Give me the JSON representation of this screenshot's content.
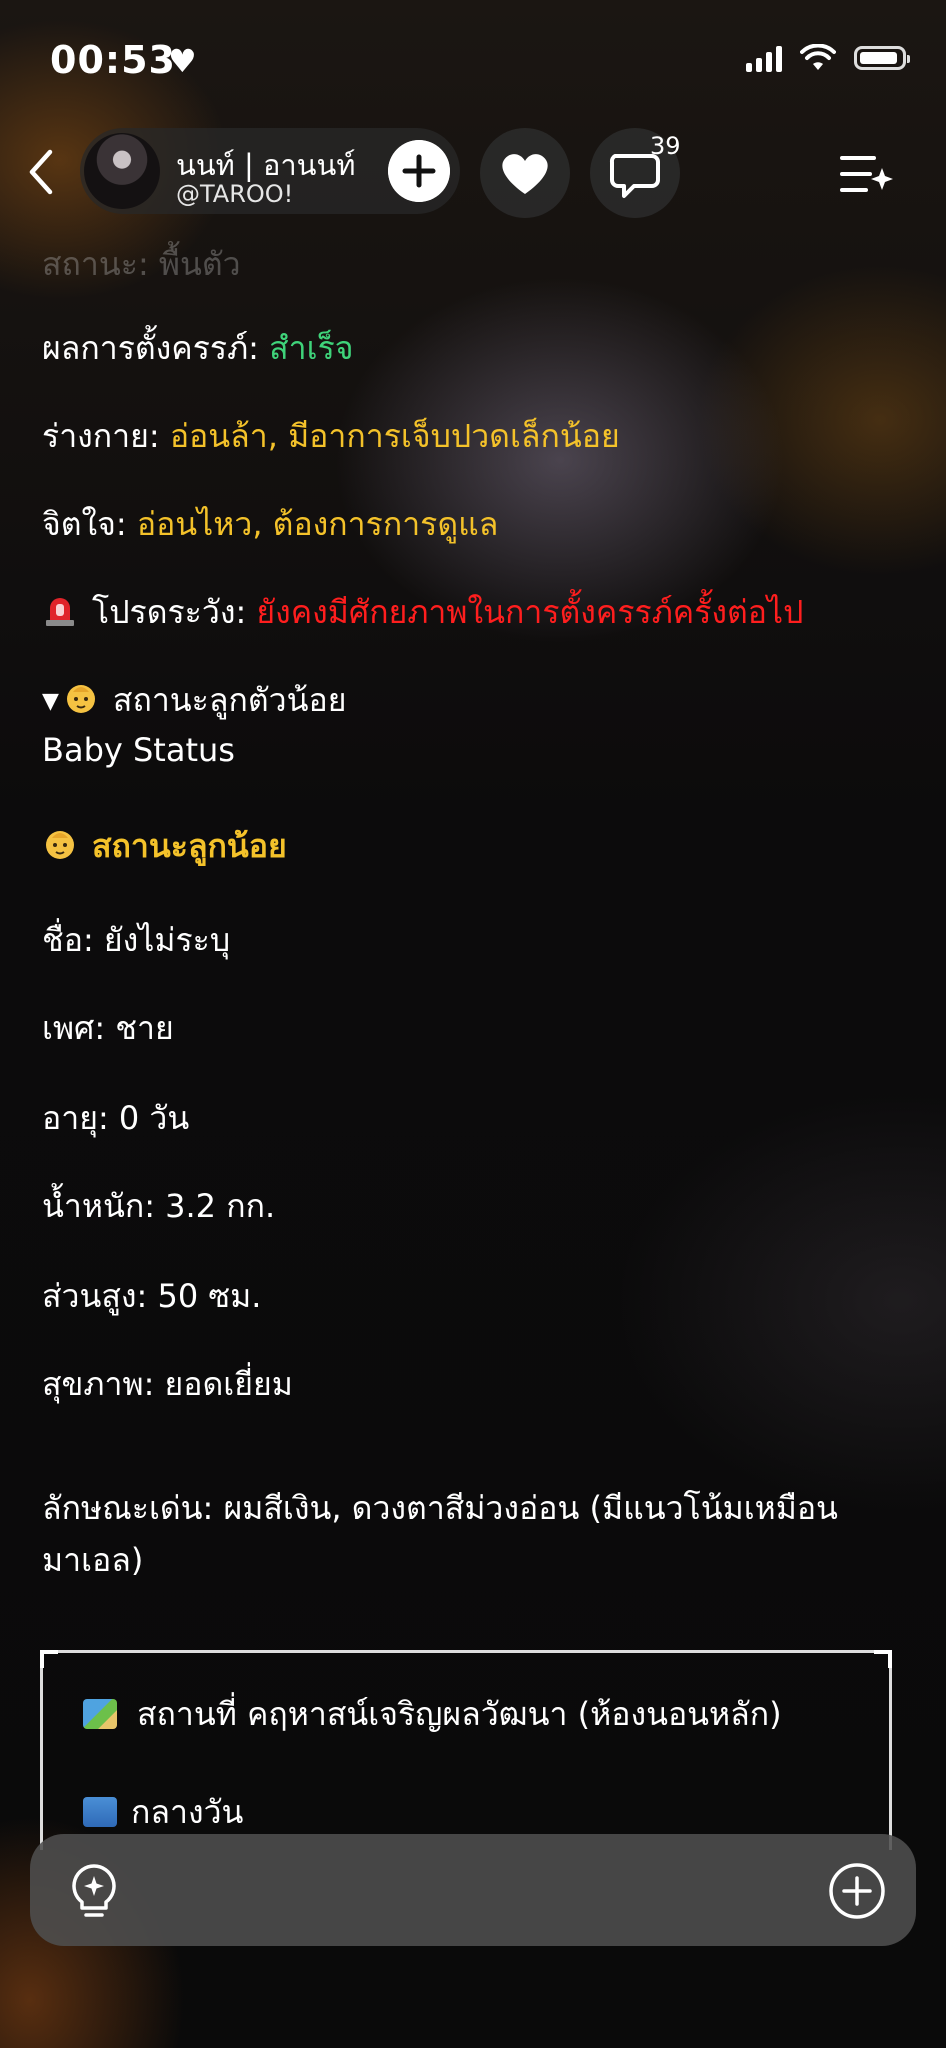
{
  "status_bar": {
    "time": "00:53",
    "time_suffix": "♥"
  },
  "header": {
    "name": "นนท์ | อานนท์",
    "handle": "@TAROO!",
    "comment_count": "39"
  },
  "status_lines": {
    "cut_off_line": "สถานะ: พื้นตัว",
    "pregnancy_label": "ผลการตั้งครรภ์: ",
    "pregnancy_value": "สำเร็จ",
    "body_label": "ร่างกาย: ",
    "body_value": "อ่อนล้า, มีอาการเจ็บปวดเล็กน้อย",
    "mind_label": "จิตใจ: ",
    "mind_value": "อ่อนไหว, ต้องการการดูแล",
    "warning_label": "โปรดระวัง: ",
    "warning_value": "ยังคงมีศักยภาพในการตั้งครรภ์ครั้งต่อไป"
  },
  "baby_toggle": {
    "arrow": "▼",
    "title": "สถานะลูกตัวน้อย",
    "subtitle": "Baby Status"
  },
  "baby_section": {
    "heading": "สถานะลูกน้อย",
    "name": "ชื่อ: ยังไม่ระบุ",
    "gender": "เพศ: ชาย",
    "age": "อายุ: 0 วัน",
    "weight": "น้ำหนัก: 3.2 กก.",
    "height": "ส่วนสูง: 50 ซม.",
    "health": "สุขภาพ: ยอดเยี่ยม",
    "features_line1": "ลักษณะเด่น: ผมสีเงิน, ดวงตาสีม่วงอ่อน (มีแนวโน้มเหมือน",
    "features_line2": "มาเอล)"
  },
  "scene": {
    "location": "สถานที่ คฤหาสน์เจริญผลวัฒนา (ห้องนอนหลัก)",
    "time_of_day": "กลางวัน"
  },
  "icons": {
    "siren": "siren-icon",
    "baby": "baby-icon",
    "map": "map-icon",
    "cityscape": "cityscape-icon"
  },
  "colors": {
    "yellow_text": "#f4c22a",
    "green_text": "#3fd37a",
    "red_text": "#ff1e1e"
  }
}
